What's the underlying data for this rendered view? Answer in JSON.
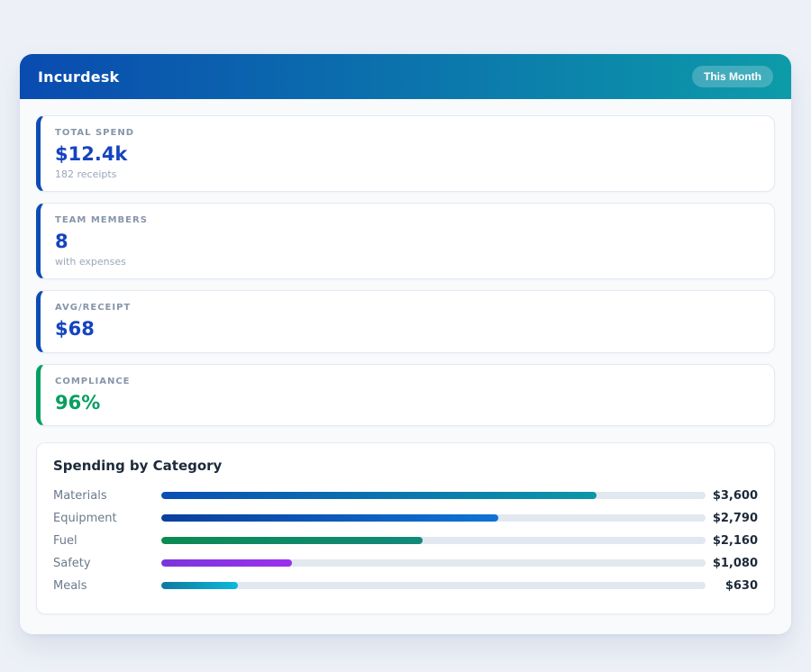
{
  "colors": {
    "header_gradient_from": "#0a4bb0",
    "header_gradient_to": "#0d9ba9",
    "stat_blue": "#1544c0",
    "stat_green": "#069e62",
    "bar_track": "#e2e8f0"
  },
  "header": {
    "title": "Incurdesk",
    "badge": "This Month"
  },
  "stats": [
    {
      "label": "TOTAL SPEND",
      "value": "$12.4k",
      "subtitle": "182 receipts",
      "accent": "#0c4cb3",
      "value_color": "#1544c0"
    },
    {
      "label": "TEAM MEMBERS",
      "value": "8",
      "subtitle": "with expenses",
      "accent": "#0c4cb3",
      "value_color": "#1544c0"
    },
    {
      "label": "AVG/RECEIPT",
      "value": "$68",
      "subtitle": "",
      "accent": "#0c4cb3",
      "value_color": "#1544c0"
    },
    {
      "label": "COMPLIANCE",
      "value": "96%",
      "subtitle": "",
      "accent": "#069e62",
      "value_color": "#069e62"
    }
  ],
  "spending": {
    "title": "Spending by Category",
    "rows": [
      {
        "label": "Materials",
        "value_label": "$3,600",
        "value": 3600,
        "width_pct": 80,
        "color_from": "#0b4fb3",
        "color_to": "#0d96a8"
      },
      {
        "label": "Equipment",
        "value_label": "$2,790",
        "value": 2790,
        "width_pct": 62,
        "color_from": "#0b3f9e",
        "color_to": "#0e74d6"
      },
      {
        "label": "Fuel",
        "value_label": "$2,160",
        "value": 2160,
        "width_pct": 48,
        "color_from": "#0c8a52",
        "color_to": "#12897c"
      },
      {
        "label": "Safety",
        "value_label": "$1,080",
        "value": 1080,
        "width_pct": 24,
        "color_from": "#7a35dc",
        "color_to": "#9b30ee"
      },
      {
        "label": "Meals",
        "value_label": "$630",
        "value": 630,
        "width_pct": 14,
        "color_from": "#0e7a9e",
        "color_to": "#0cb8dc"
      }
    ]
  },
  "chart_data": {
    "type": "bar",
    "orientation": "horizontal",
    "title": "Spending by Category",
    "categories": [
      "Materials",
      "Equipment",
      "Fuel",
      "Safety",
      "Meals"
    ],
    "values": [
      3600,
      2790,
      2160,
      1080,
      630
    ],
    "value_labels": [
      "$3,600",
      "$2,790",
      "$2,160",
      "$1,080",
      "$630"
    ],
    "xlim": [
      0,
      4500
    ],
    "grid": false,
    "legend": false
  }
}
